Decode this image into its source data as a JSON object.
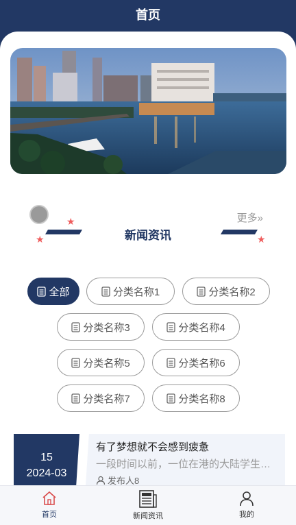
{
  "header": {
    "title": "首页"
  },
  "section": {
    "title": "新闻资讯",
    "more_label": "更多"
  },
  "categories": [
    {
      "label": "全部",
      "active": true
    },
    {
      "label": "分类名称1"
    },
    {
      "label": "分类名称2"
    },
    {
      "label": "分类名称3"
    },
    {
      "label": "分类名称4"
    },
    {
      "label": "分类名称5"
    },
    {
      "label": "分类名称6"
    },
    {
      "label": "分类名称7"
    },
    {
      "label": "分类名称8"
    }
  ],
  "news": [
    {
      "day": "15",
      "year_month": "2024-03",
      "title": "有了梦想就不会感到疲惫",
      "summary": "一段时间以前，一位在港的大陆学生跟我说，他在香港打拼得很辛苦",
      "author": "发布人8"
    }
  ],
  "tabbar": {
    "items": [
      {
        "label": "首页",
        "icon": "home-icon",
        "active": true
      },
      {
        "label": "新闻资讯",
        "icon": "newspaper-icon"
      },
      {
        "label": "我的",
        "icon": "person-icon"
      }
    ]
  },
  "colors": {
    "primary": "#223864",
    "accent": "#ef5d5d",
    "chip_border": "#999999"
  }
}
